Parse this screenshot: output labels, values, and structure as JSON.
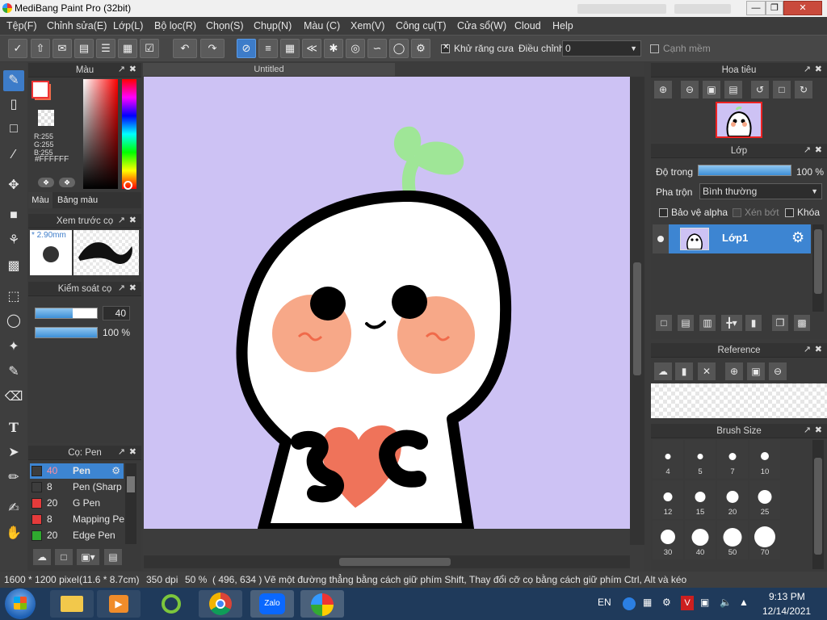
{
  "window": {
    "title": "MediBang Paint Pro (32bit)"
  },
  "menu": [
    "Tệp(F)",
    "Chỉnh sửa(E)",
    "Lớp(L)",
    "Bộ lọc(R)",
    "Chọn(S)",
    "Chụp(N)",
    "Màu (C)",
    "Xem(V)",
    "Công cụ(T)",
    "Cửa sổ(W)",
    "Cloud",
    "Help"
  ],
  "toolbar": {
    "antialias_label": "Khử răng cưa",
    "adjust_label": "Điều chỉnh",
    "adjust_value": "0",
    "smooth_edge_label": "Cạnh mềm"
  },
  "color_panel": {
    "title": "Màu",
    "r": "R:255",
    "g": "G:255",
    "b": "B:255",
    "hex": "#FFFFFF",
    "tab_color": "Màu",
    "tab_palette": "Bảng màu",
    "fg_color": "#ffffff",
    "bg_color": "#f06a4a"
  },
  "brush_preview": {
    "title": "Xem trước cọ",
    "size_label": "* 2.90mm"
  },
  "brush_control": {
    "title": "Kiểm soát cọ",
    "size_value": "40",
    "size_fraction": 0.6,
    "opacity_value": "100 %",
    "opacity_fraction": 1.0
  },
  "brush_list": {
    "title": "Cọ: Pen",
    "items": [
      {
        "size": "40",
        "name": "Pen",
        "color": "#3d3d3d",
        "selected": true
      },
      {
        "size": "8",
        "name": "Pen (Sharp",
        "color": "#3d3d3d",
        "selected": false
      },
      {
        "size": "20",
        "name": "G Pen",
        "color": "#e43b3b",
        "selected": false
      },
      {
        "size": "8",
        "name": "Mapping Pe",
        "color": "#e43b3b",
        "selected": false
      },
      {
        "size": "20",
        "name": "Edge Pen",
        "color": "#2faa2f",
        "selected": false
      }
    ]
  },
  "canvas_tab": {
    "title": "Untitled"
  },
  "navigator": {
    "title": "Hoa tiêu"
  },
  "layer_panel": {
    "title": "Lớp",
    "opacity_label": "Độ trong",
    "opacity_value": "100 %",
    "opacity_fraction": 1.0,
    "blend_label": "Pha trộn",
    "blend_value": "Bình thường",
    "alpha_protect": "Bảo vệ alpha",
    "clipping": "Xén bớt",
    "lock": "Khóa",
    "layers": [
      {
        "name": "Lớp1"
      }
    ]
  },
  "reference_panel": {
    "title": "Reference"
  },
  "brush_size_panel": {
    "title": "Brush Size",
    "sizes": [
      "4",
      "5",
      "7",
      "10",
      "12",
      "15",
      "20",
      "25",
      "30",
      "40",
      "50",
      "70"
    ]
  },
  "status": {
    "dimensions": "1600 * 1200 pixel",
    "physical": "(11.6 * 8.7cm)",
    "dpi": "350 dpi",
    "zoom": "50 %",
    "cursor": "( 496, 634 )",
    "hint": "Vẽ một đường thẳng bằng cách giữ phím Shift, Thay đổi cỡ cọ bằng cách giữ phím Ctrl, Alt và kéo"
  },
  "taskbar": {
    "language": "EN",
    "time": "9:13 PM",
    "date": "12/14/2021",
    "zalo_label": "Zalo"
  }
}
